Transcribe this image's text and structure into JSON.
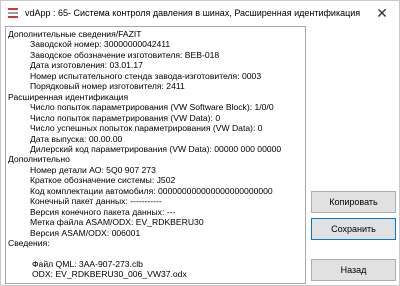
{
  "window": {
    "title": "vdApp : 65- Система контроля давления в шинах,  Расширенная идентификация",
    "close_glyph": "✕"
  },
  "info": {
    "lines": [
      {
        "text": "Дополнительные сведения/FAZIT",
        "level": 0
      },
      {
        "text": "Заводской номер: 30000000042411",
        "level": 1
      },
      {
        "text": "Заводское обозначение изготовителя: BEB-018",
        "level": 1
      },
      {
        "text": "Дата изготовления: 03.01.17",
        "level": 1
      },
      {
        "text": "Номер испытательного стенда завода-изготовителя: 0003",
        "level": 1
      },
      {
        "text": "Порядковый номер изготовителя: 2411",
        "level": 1
      },
      {
        "text": "Расширенная идентификация",
        "level": 0
      },
      {
        "text": "Число попыток параметрирования (VW Software Block): 1/0/0",
        "level": 1
      },
      {
        "text": "Число попыток параметрирования (VW Data): 0",
        "level": 1
      },
      {
        "text": "Число успешных попыток параметрирования (VW Data): 0",
        "level": 1
      },
      {
        "text": "Дата выпуска: 00.00.00",
        "level": 1
      },
      {
        "text": "Дилерский код параметрирования (VW Data): 00000 000 00000",
        "level": 1
      },
      {
        "text": "Дополнительно",
        "level": 0
      },
      {
        "text": "Номер детали АО: 5Q0 907 273",
        "level": 1
      },
      {
        "text": "Краткое обозначение системы: J502",
        "level": 1
      },
      {
        "text": "Код комплектации автомобиля: 000000000000000000000000",
        "level": 1
      },
      {
        "text": "Конечный пакет данных: -----------",
        "level": 1
      },
      {
        "text": "Версия конечного пакета данных: ---",
        "level": 1
      },
      {
        "text": "Метка файла ASAM/ODX: EV_RDKBERU30",
        "level": 1
      },
      {
        "text": "Версия ASAM/ODX: 006001",
        "level": 1
      },
      {
        "text": "Сведения:",
        "level": 0
      },
      {
        "text": "",
        "level": 0
      },
      {
        "text": "Файл QML: 3AA-907-273.clb",
        "level": 2
      },
      {
        "text": "ODX: EV_RDKBERU30_006_VW37.odx",
        "level": 2
      }
    ]
  },
  "buttons": {
    "copy": "Копировать",
    "save": "Сохранить",
    "back": "Назад"
  },
  "colors": {
    "icon_red": "#d23a2f",
    "icon_gray": "#9aa0a6",
    "button_bg": "#e1e1e1",
    "focus_border": "#0078d7"
  }
}
